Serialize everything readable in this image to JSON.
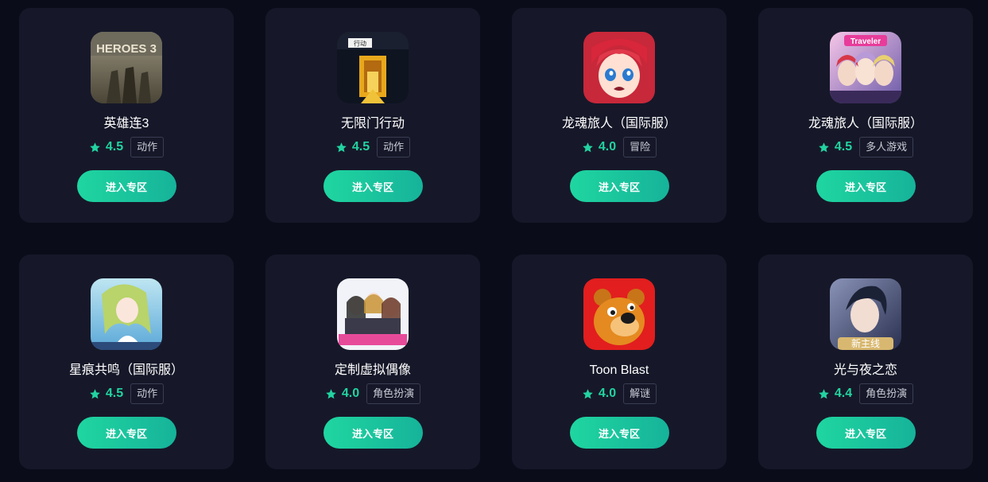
{
  "enter_label": "进入专区",
  "accent_color": "#22d3a0",
  "games": [
    {
      "title": "英雄连3",
      "rating": "4.5",
      "tag": "动作",
      "icon": "company-of-heroes-3-icon",
      "thumb_text": "HEROES 3"
    },
    {
      "title": "无限门行动",
      "rating": "4.5",
      "tag": "动作",
      "icon": "infinite-door-icon",
      "thumb_text": "行动"
    },
    {
      "title": "龙魂旅人（国际服）",
      "rating": "4.0",
      "tag": "冒险",
      "icon": "red-hair-girl-icon",
      "thumb_text": ""
    },
    {
      "title": "龙魂旅人（国际服）",
      "rating": "4.5",
      "tag": "多人游戏",
      "icon": "traveler-characters-icon",
      "thumb_text": "Traveler"
    },
    {
      "title": "星痕共鸣（国际服）",
      "rating": "4.5",
      "tag": "动作",
      "icon": "green-hair-girl-icon",
      "thumb_text": ""
    },
    {
      "title": "定制虚拟偶像",
      "rating": "4.0",
      "tag": "角色扮演",
      "icon": "idol-group-icon",
      "thumb_text": ""
    },
    {
      "title": "Toon Blast",
      "rating": "4.0",
      "tag": "解谜",
      "icon": "cartoon-bear-icon",
      "thumb_text": ""
    },
    {
      "title": "光与夜之恋",
      "rating": "4.4",
      "tag": "角色扮演",
      "icon": "dark-hair-man-icon",
      "thumb_text": "新主线"
    }
  ]
}
